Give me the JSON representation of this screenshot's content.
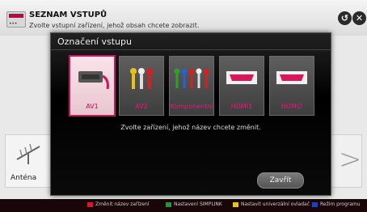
{
  "header": {
    "title": "SEZNAM VSTUPŮ",
    "subtitle": "Zvolte vstupní zařízení, jehož obsah chcete zobrazit.",
    "back_glyph": "↺",
    "close_glyph": "✕"
  },
  "background": {
    "antenna_label": "Anténa"
  },
  "modal": {
    "title": "Označení vstupu",
    "tiles": [
      {
        "label": "AV1",
        "icon": "scart-cable-icon",
        "selected": true
      },
      {
        "label": "AV2",
        "icon": "rca-cable-icon"
      },
      {
        "label": "Komponentní",
        "icon": "component-cable-icon"
      },
      {
        "label": "HDMI1",
        "icon": "hdmi-port-icon"
      },
      {
        "label": "HDMI2",
        "icon": "hdmi-port-icon"
      }
    ],
    "message": "Zvolte zařízení, jehož název chcete změnit.",
    "close_label": "Zavřít"
  },
  "bottom_bar": {
    "hints": [
      {
        "label": "Změnit název zařízení",
        "color": "#e0142c"
      },
      {
        "label": "Nastavení SIMPLINK",
        "color": "#1a9a3a"
      },
      {
        "label": "Nastavit univerzální ovladač",
        "color": "#e6c21a"
      },
      {
        "label": "Režim programu",
        "color": "#1a3fc9"
      }
    ]
  },
  "colors": {
    "accent": "#c9185f"
  }
}
